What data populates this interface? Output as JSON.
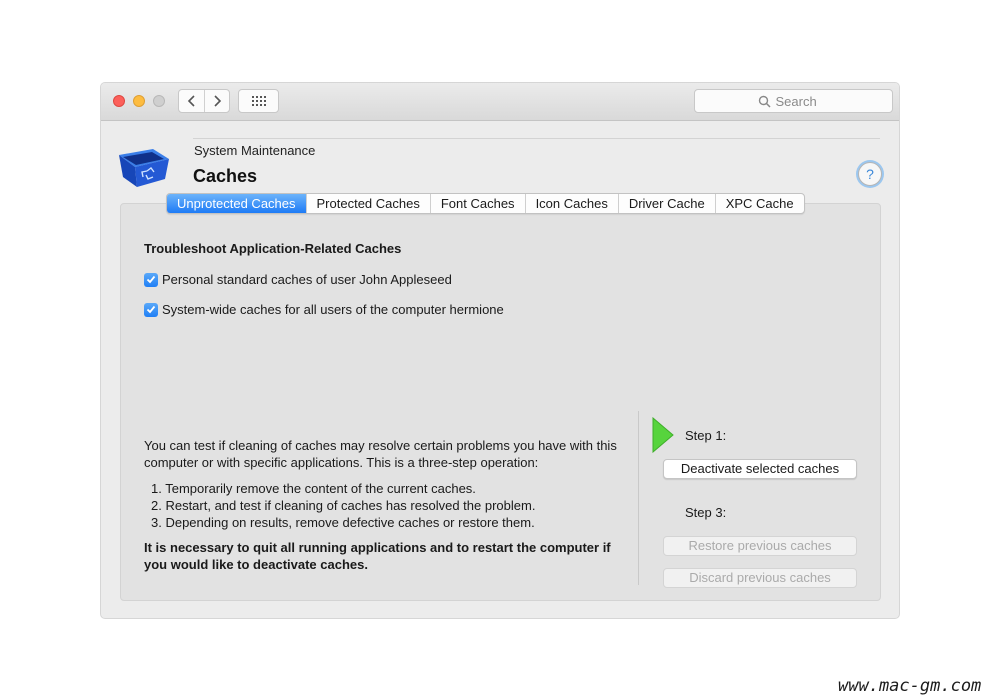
{
  "window": {
    "search": {
      "placeholder": "Search"
    },
    "icons": [
      "close-button",
      "minimize-button",
      "zoom-button",
      "chevron-left-icon",
      "chevron-right-icon",
      "grid-icon",
      "search-icon"
    ]
  },
  "header": {
    "section": "System Maintenance",
    "title": "Caches",
    "help_label": "?"
  },
  "tabs": [
    {
      "label": "Unprotected Caches",
      "active": true
    },
    {
      "label": "Protected Caches",
      "active": false
    },
    {
      "label": "Font Caches",
      "active": false
    },
    {
      "label": "Icon Caches",
      "active": false
    },
    {
      "label": "Driver Cache",
      "active": false
    },
    {
      "label": "XPC Cache",
      "active": false
    }
  ],
  "main": {
    "heading": "Troubleshoot Application-Related Caches",
    "options": [
      {
        "label": "Personal standard caches of user John Appleseed",
        "checked": true
      },
      {
        "label": "System-wide caches for all users of the computer hermione",
        "checked": true
      }
    ],
    "intro": "You can test if cleaning of caches may resolve certain problems you have with this computer or with specific applications. This is a three-step operation:",
    "steps": [
      "1. Temporarily remove the content of the current caches.",
      "2. Restart, and test if cleaning of caches has resolved the problem.",
      "3. Depending on results, remove defective caches or restore them."
    ],
    "warning": "It is necessary to quit all running applications and to restart the computer if you would like to deactivate caches."
  },
  "actions": {
    "step1_label": "Step 1:",
    "deactivate_label": "Deactivate selected caches",
    "step3_label": "Step 3:",
    "restore_label": "Restore previous caches",
    "discard_label": "Discard previous caches",
    "restore_enabled": false,
    "discard_enabled": false
  },
  "watermark": "www.mac-gm.com",
  "colors": {
    "accent": "#1e7bf6",
    "step_arrow": "#57d43d",
    "window_bg": "#ececec"
  }
}
